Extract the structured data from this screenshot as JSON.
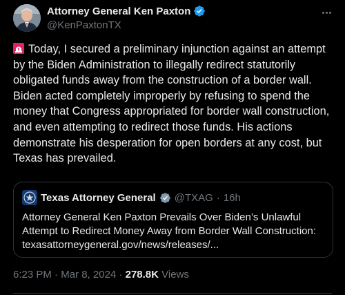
{
  "author": {
    "display_name": "Attorney General Ken Paxton",
    "handle": "@KenPaxtonTX"
  },
  "tweet": {
    "lead_icon": "rotating-light-icon",
    "text": "Today, I secured a preliminary injunction against an attempt by the Biden Administration to illegally redirect statutorily obligated funds away from the construction of a border wall. Biden acted completely improperly by refusing to spend the money that Congress appropriated for border wall construction, and even attempting to redirect those funds. His actions demonstrate his desperation for open borders at any cost, but Texas has prevailed."
  },
  "quoted_tweet": {
    "display_name": "Texas Attorney General",
    "handle": "@TXAG",
    "separator": "·",
    "age": "16h",
    "text": "Attorney General Ken Paxton Prevails Over Biden’s Unlawful Attempt to Redirect Money Away from Border Wall Construction: texasattorneygeneral.gov/news/releases/..."
  },
  "meta": {
    "time": "6:23 PM",
    "separator": "·",
    "date": "Mar 8, 2024",
    "views_count": "278.8K",
    "views_label": "Views"
  },
  "colors": {
    "background": "#000000",
    "text_primary": "#e7e9ea",
    "text_secondary": "#71767b",
    "verified_blue": "#1d9bf0",
    "verified_gray": "#829aab",
    "border": "#2f3336"
  }
}
